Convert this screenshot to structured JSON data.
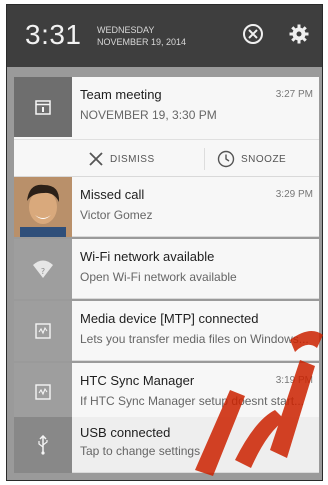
{
  "status": {
    "time": "3:31",
    "weekday": "WEDNESDAY",
    "date": "NOVEMBER 19, 2014"
  },
  "notifications": [
    {
      "title": "Team meeting",
      "subtitle": "NOVEMBER 19, 3:30 PM",
      "time": "3:27 PM",
      "actions": {
        "dismiss": "DISMISS",
        "snooze": "SNOOZE"
      }
    },
    {
      "title": "Missed call",
      "subtitle": "Victor Gomez",
      "time": "3:29 PM"
    },
    {
      "title": "Wi-Fi network available",
      "subtitle": "Open Wi-Fi network available",
      "time": ""
    },
    {
      "title": "Media device [MTP] connected",
      "subtitle": "Lets you transfer media files on Windows...",
      "time": ""
    },
    {
      "title": "HTC Sync Manager",
      "subtitle": "If HTC Sync Manager setup doesnt start...",
      "time": "3:19 PM"
    },
    {
      "title": "USB connected",
      "subtitle": "Tap to change settings",
      "time": ""
    }
  ],
  "colors": {
    "header": "#3e3e3e",
    "card": "#f7f7f7",
    "icon_bg": "#6e6e6e",
    "watermark": "#cc2200"
  },
  "icons": [
    "dismiss-all-icon",
    "settings-gear-icon",
    "calendar-icon",
    "wifi-icon",
    "media-device-icon",
    "sync-icon",
    "usb-icon"
  ]
}
